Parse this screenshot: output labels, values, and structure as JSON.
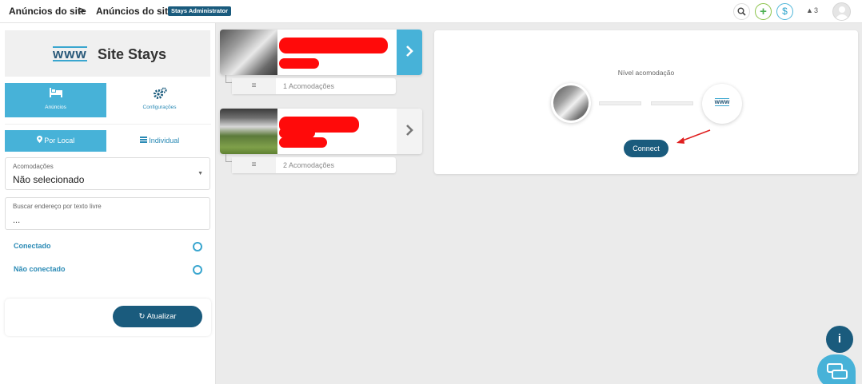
{
  "topbar": {
    "crumb1": "Anúncios do site",
    "sep": ">",
    "crumb2": "Anúncios do site",
    "role_badge": "Stays Administrator",
    "plus_glyph": "+",
    "dollar_glyph": "$",
    "alert_glyph": "▲",
    "alert_count": "3",
    "icons": [
      "search-icon",
      "plus-icon",
      "dollar-icon",
      "alert-icon",
      "avatar"
    ]
  },
  "sidebar": {
    "logo_www": "www",
    "logo_name": "Site Stays",
    "tab_anuncios": "Anúncios",
    "tab_config": "Configurações",
    "tab_local": "Por Local",
    "tab_individual": "Individual",
    "select_label": "Acomodações",
    "select_value": "Não selecionado",
    "search_label": "Buscar endereço por texto livre",
    "search_value": "...",
    "radio_connected": "Conectado",
    "radio_not_connected": "Não conectado",
    "refresh_button": "Atualizar"
  },
  "listings": [
    {
      "count_label": "1 Acomodações",
      "active": true
    },
    {
      "count_label": "2 Acomodações",
      "active": false
    }
  ],
  "panel": {
    "title": "Nível acomodação",
    "www": "www",
    "connect_button": "Connect"
  },
  "fab": {
    "info_glyph": "i"
  },
  "colors": {
    "accent": "#47b2d8",
    "primary_dark": "#1a5b7d",
    "redaction": "#ff0a0a"
  }
}
